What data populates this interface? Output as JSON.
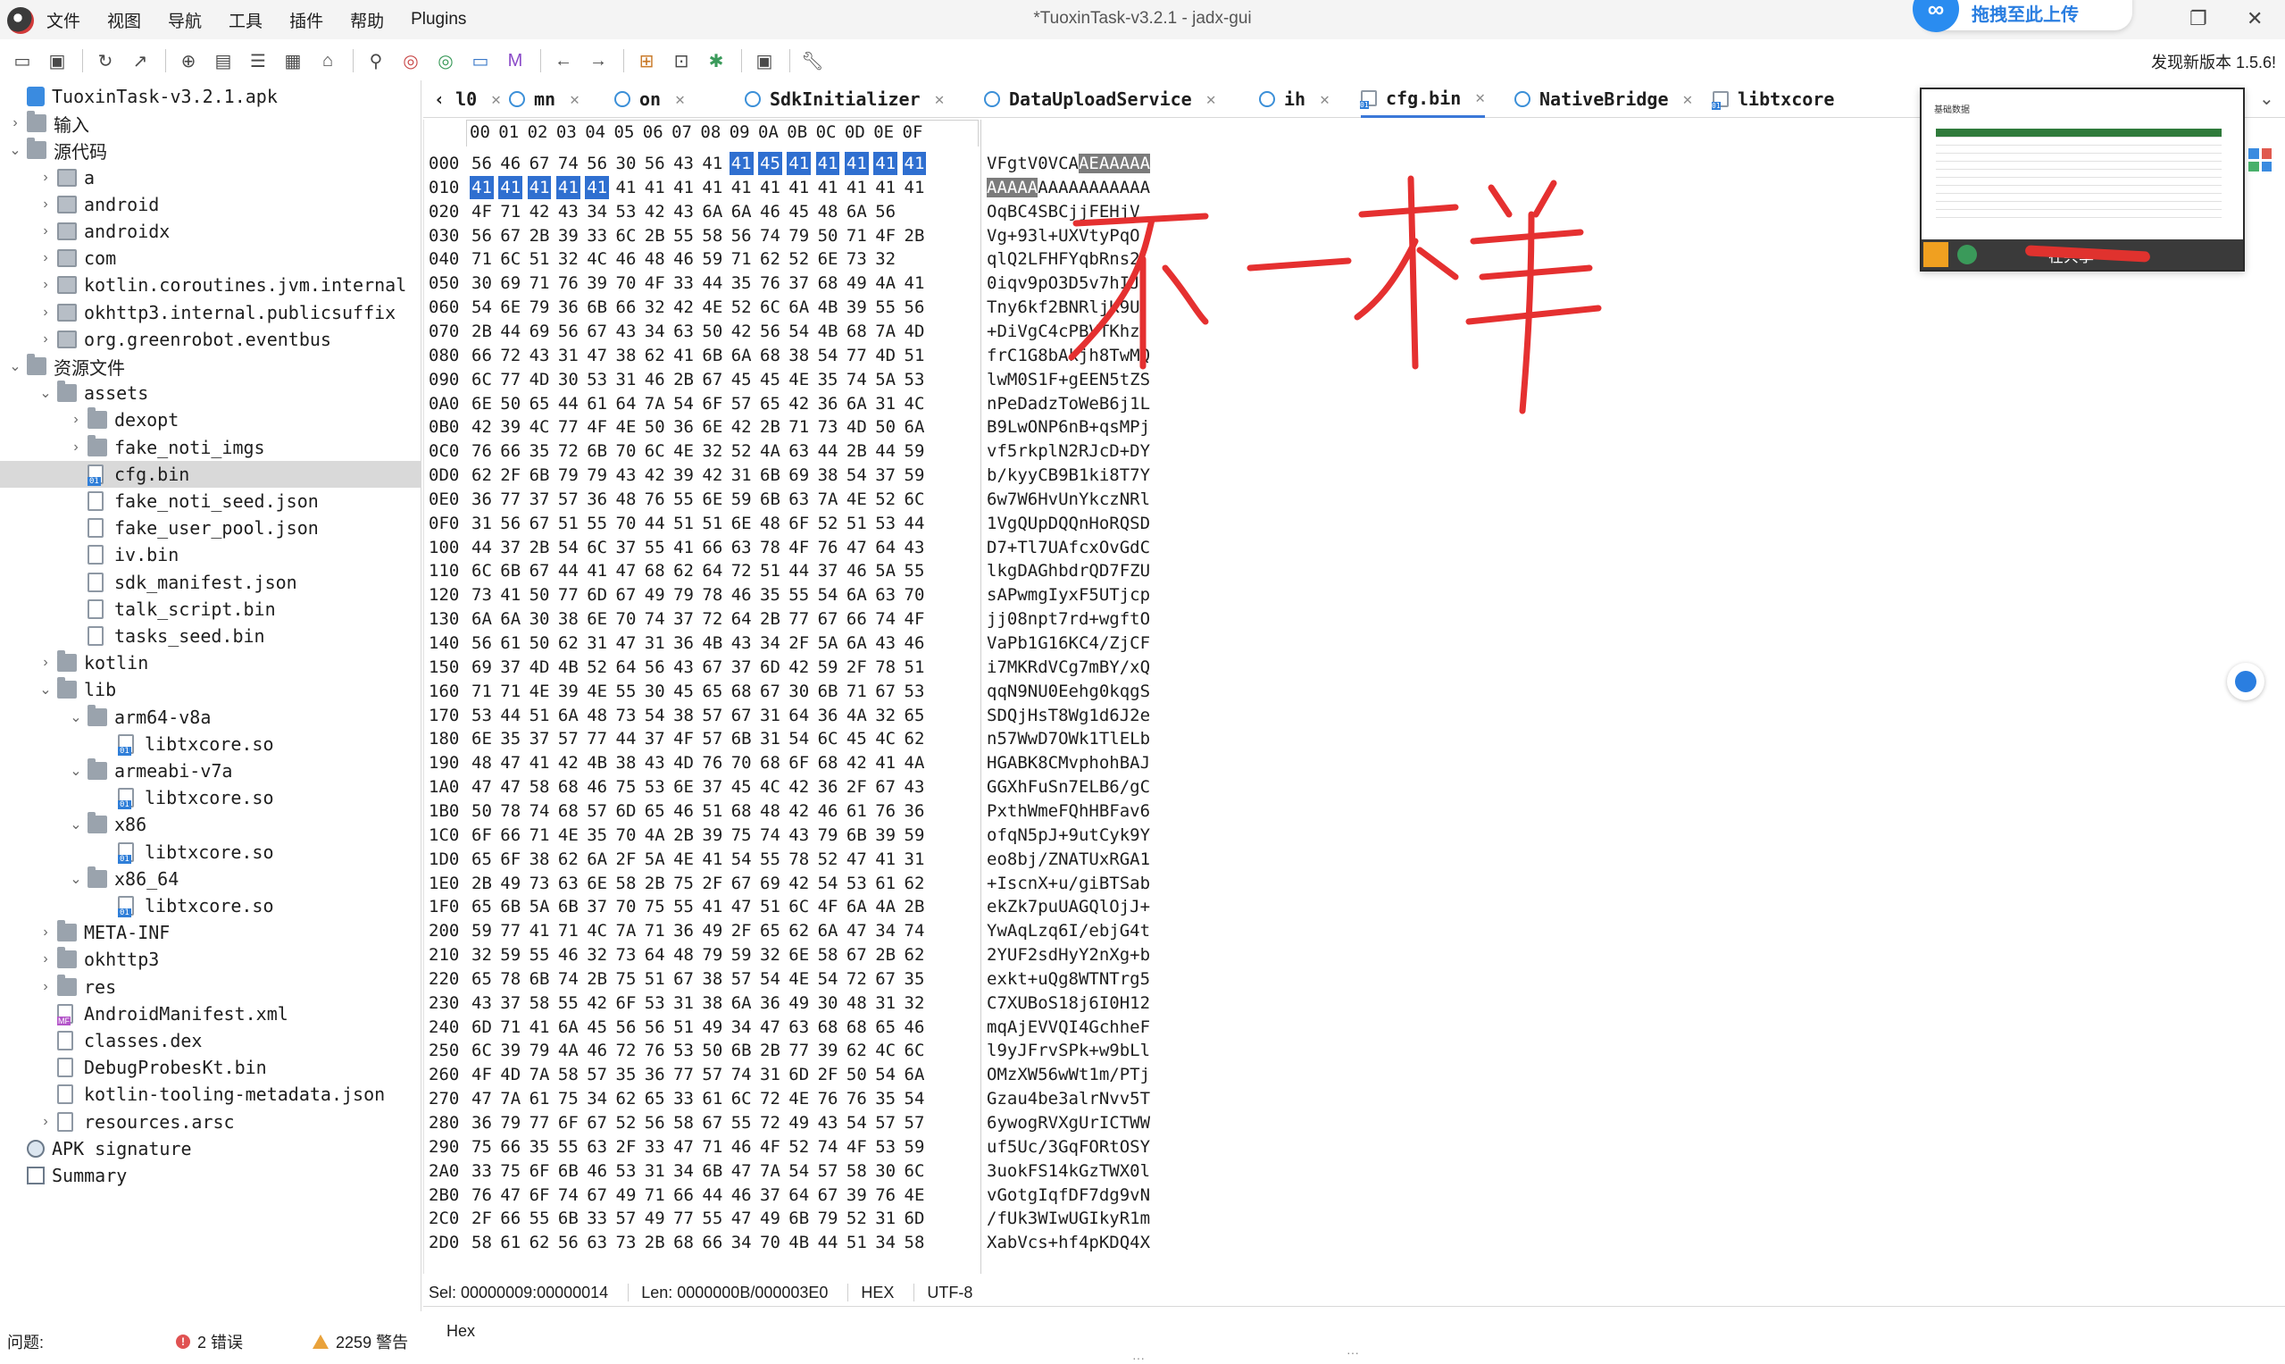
{
  "window": {
    "title": "*TuoxinTask-v3.2.1 - jadx-gui",
    "menus": [
      "文件",
      "视图",
      "导航",
      "工具",
      "插件",
      "帮助",
      "Plugins"
    ],
    "upload_banner": "拖拽至此上传",
    "update_notice": "发现新版本 1.5.6!"
  },
  "toolbar": {
    "icons": [
      "open-file-icon",
      "save-icon",
      "reload-icon",
      "export-icon",
      "sync-icon",
      "add-files-icon",
      "flatten-icon",
      "grid-icon",
      "home-icon",
      "search-icon",
      "find-class-icon",
      "find-usage-icon",
      "code-view-icon",
      "smali-icon",
      "back-icon",
      "forward-icon",
      "deobf-icon",
      "log-icon",
      "debug-icon",
      "quark-icon",
      "preferences-icon"
    ]
  },
  "tree": {
    "items": [
      {
        "label": "TuoxinTask-v3.2.1.apk",
        "icon": "apk-icon",
        "level": 0,
        "arrow": "",
        "mono": true
      },
      {
        "label": "输入",
        "icon": "folder-icon",
        "level": 0,
        "arrow": "›",
        "mono": false
      },
      {
        "label": "源代码",
        "icon": "folder-icon",
        "level": 0,
        "arrow": "⌄",
        "mono": false
      },
      {
        "label": "a",
        "icon": "package-icon",
        "level": 1,
        "arrow": "›",
        "mono": true
      },
      {
        "label": "android",
        "icon": "package-icon",
        "level": 1,
        "arrow": "›",
        "mono": true
      },
      {
        "label": "androidx",
        "icon": "package-icon",
        "level": 1,
        "arrow": "›",
        "mono": true
      },
      {
        "label": "com",
        "icon": "package-icon",
        "level": 1,
        "arrow": "›",
        "mono": true
      },
      {
        "label": "kotlin.coroutines.jvm.internal",
        "icon": "package-icon",
        "level": 1,
        "arrow": "›",
        "mono": true
      },
      {
        "label": "okhttp3.internal.publicsuffix",
        "icon": "package-icon",
        "level": 1,
        "arrow": "›",
        "mono": true
      },
      {
        "label": "org.greenrobot.eventbus",
        "icon": "package-icon",
        "level": 1,
        "arrow": "›",
        "mono": true
      },
      {
        "label": "资源文件",
        "icon": "folder-icon",
        "level": 0,
        "arrow": "⌄",
        "mono": false
      },
      {
        "label": "assets",
        "icon": "folder-icon",
        "level": 1,
        "arrow": "⌄",
        "mono": true
      },
      {
        "label": "dexopt",
        "icon": "folder-icon",
        "level": 2,
        "arrow": "›",
        "mono": true
      },
      {
        "label": "fake_noti_imgs",
        "icon": "folder-icon",
        "level": 2,
        "arrow": "›",
        "mono": true
      },
      {
        "label": "cfg.bin",
        "icon": "binary-file-icon",
        "level": 2,
        "arrow": "",
        "mono": true,
        "selected": true
      },
      {
        "label": "fake_noti_seed.json",
        "icon": "file-icon",
        "level": 2,
        "arrow": "",
        "mono": true
      },
      {
        "label": "fake_user_pool.json",
        "icon": "file-icon",
        "level": 2,
        "arrow": "",
        "mono": true
      },
      {
        "label": "iv.bin",
        "icon": "file-icon",
        "level": 2,
        "arrow": "",
        "mono": true
      },
      {
        "label": "sdk_manifest.json",
        "icon": "file-icon",
        "level": 2,
        "arrow": "",
        "mono": true
      },
      {
        "label": "talk_script.bin",
        "icon": "file-icon",
        "level": 2,
        "arrow": "",
        "mono": true
      },
      {
        "label": "tasks_seed.bin",
        "icon": "file-icon",
        "level": 2,
        "arrow": "",
        "mono": true
      },
      {
        "label": "kotlin",
        "icon": "folder-icon",
        "level": 1,
        "arrow": "›",
        "mono": true
      },
      {
        "label": "lib",
        "icon": "folder-icon",
        "level": 1,
        "arrow": "⌄",
        "mono": true
      },
      {
        "label": "arm64-v8a",
        "icon": "folder-icon",
        "level": 2,
        "arrow": "⌄",
        "mono": true
      },
      {
        "label": "libtxcore.so",
        "icon": "binary-file-icon",
        "level": 3,
        "arrow": "",
        "mono": true
      },
      {
        "label": "armeabi-v7a",
        "icon": "folder-icon",
        "level": 2,
        "arrow": "⌄",
        "mono": true
      },
      {
        "label": "libtxcore.so",
        "icon": "binary-file-icon",
        "level": 3,
        "arrow": "",
        "mono": true
      },
      {
        "label": "x86",
        "icon": "folder-icon",
        "level": 2,
        "arrow": "⌄",
        "mono": true
      },
      {
        "label": "libtxcore.so",
        "icon": "binary-file-icon",
        "level": 3,
        "arrow": "",
        "mono": true
      },
      {
        "label": "x86_64",
        "icon": "folder-icon",
        "level": 2,
        "arrow": "⌄",
        "mono": true
      },
      {
        "label": "libtxcore.so",
        "icon": "binary-file-icon",
        "level": 3,
        "arrow": "",
        "mono": true
      },
      {
        "label": "META-INF",
        "icon": "folder-icon",
        "level": 1,
        "arrow": "›",
        "mono": true
      },
      {
        "label": "okhttp3",
        "icon": "folder-icon",
        "level": 1,
        "arrow": "›",
        "mono": true
      },
      {
        "label": "res",
        "icon": "folder-icon",
        "level": 1,
        "arrow": "›",
        "mono": true
      },
      {
        "label": "AndroidManifest.xml",
        "icon": "manifest-icon",
        "level": 1,
        "arrow": "",
        "mono": true
      },
      {
        "label": "classes.dex",
        "icon": "file-icon",
        "level": 1,
        "arrow": "",
        "mono": true
      },
      {
        "label": "DebugProbesKt.bin",
        "icon": "file-icon",
        "level": 1,
        "arrow": "",
        "mono": true
      },
      {
        "label": "kotlin-tooling-metadata.json",
        "icon": "file-icon",
        "level": 1,
        "arrow": "",
        "mono": true
      },
      {
        "label": "resources.arsc",
        "icon": "file-icon",
        "level": 1,
        "arrow": "›",
        "mono": true
      },
      {
        "label": "APK signature",
        "icon": "certificate-icon",
        "level": 0,
        "arrow": "",
        "mono": true
      },
      {
        "label": "Summary",
        "icon": "summary-icon",
        "level": 0,
        "arrow": "",
        "mono": true
      }
    ]
  },
  "tabs": [
    {
      "label": "‹ l0",
      "icon": "",
      "active": false
    },
    {
      "label": "mn",
      "icon": "class-icon",
      "active": false
    },
    {
      "label": "on",
      "icon": "class-icon",
      "active": false
    },
    {
      "label": "SdkInitializer",
      "icon": "class-icon",
      "active": false
    },
    {
      "label": "DataUploadService",
      "icon": "class-icon",
      "active": false
    },
    {
      "label": "ih",
      "icon": "class-icon",
      "active": false
    },
    {
      "label": "cfg.bin",
      "icon": "binary-file-icon",
      "active": true
    },
    {
      "label": "NativeBridge",
      "icon": "class-icon",
      "active": false
    },
    {
      "label": "libtxcore",
      "icon": "binary-file-icon",
      "active": false
    }
  ],
  "hex": {
    "header": [
      "00",
      "01",
      "02",
      "03",
      "04",
      "05",
      "06",
      "07",
      "08",
      "09",
      "0A",
      "0B",
      "0C",
      "0D",
      "0E",
      "0F"
    ],
    "selection": {
      "start": 9,
      "end": 20,
      "ascii_start": 9,
      "ascii_end": 20
    },
    "rows": [
      {
        "off": "000",
        "bytes": "56 46 67 74 56 30 56 43 41 41 45 41 41 41 41 41",
        "ascii": "VFgtV0VCAAEAAAAA"
      },
      {
        "off": "010",
        "bytes": "41 41 41 41 41 41 41 41 41 41 41 41 41 41 41 41",
        "ascii": "AAAAAAAAAAAAAAAA"
      },
      {
        "off": "020",
        "bytes": "4F 71 42 43 34 53 42 43 6A 6A 46 45 48 6A 56",
        "ascii": "OqBC4SBCjjFEHjV"
      },
      {
        "off": "030",
        "bytes": "56 67 2B 39 33 6C 2B 55 58 56 74 79 50 71 4F 2B",
        "ascii": "Vg+93l+UXVtyPqO"
      },
      {
        "off": "040",
        "bytes": "71 6C 51 32 4C 46 48 46 59 71 62 52 6E 73 32",
        "ascii": "qlQ2LFHFYqbRns2"
      },
      {
        "off": "050",
        "bytes": "30 69 71 76 39 70 4F 33 44 35 76 37 68 49 4A 41",
        "ascii": "0iqv9pO3D5v7hIJ"
      },
      {
        "off": "060",
        "bytes": "54 6E 79 36 6B 66 32 42 4E 52 6C 6A 4B 39 55 56",
        "ascii": "Tny6kf2BNRljK9U"
      },
      {
        "off": "070",
        "bytes": "2B 44 69 56 67 43 34 63 50 42 56 54 4B 68 7A 4D",
        "ascii": "+DiVgC4cPBVTKhz"
      },
      {
        "off": "080",
        "bytes": "66 72 43 31 47 38 62 41 6B 6A 68 38 54 77 4D 51",
        "ascii": "frC1G8bAkjh8TwMQ"
      },
      {
        "off": "090",
        "bytes": "6C 77 4D 30 53 31 46 2B 67 45 45 4E 35 74 5A 53",
        "ascii": "lwM0S1F+gEEN5tZS"
      },
      {
        "off": "0A0",
        "bytes": "6E 50 65 44 61 64 7A 54 6F 57 65 42 36 6A 31 4C",
        "ascii": "nPeDadzToWeB6j1L"
      },
      {
        "off": "0B0",
        "bytes": "42 39 4C 77 4F 4E 50 36 6E 42 2B 71 73 4D 50 6A",
        "ascii": "B9LwONP6nB+qsMPj"
      },
      {
        "off": "0C0",
        "bytes": "76 66 35 72 6B 70 6C 4E 32 52 4A 63 44 2B 44 59",
        "ascii": "vf5rkplN2RJcD+DY"
      },
      {
        "off": "0D0",
        "bytes": "62 2F 6B 79 79 43 42 39 42 31 6B 69 38 54 37 59",
        "ascii": "b/kyyCB9B1ki8T7Y"
      },
      {
        "off": "0E0",
        "bytes": "36 77 37 57 36 48 76 55 6E 59 6B 63 7A 4E 52 6C",
        "ascii": "6w7W6HvUnYkczNRl"
      },
      {
        "off": "0F0",
        "bytes": "31 56 67 51 55 70 44 51 51 6E 48 6F 52 51 53 44",
        "ascii": "1VgQUpDQQnHoRQSD"
      },
      {
        "off": "100",
        "bytes": "44 37 2B 54 6C 37 55 41 66 63 78 4F 76 47 64 43",
        "ascii": "D7+Tl7UAfcxOvGdC"
      },
      {
        "off": "110",
        "bytes": "6C 6B 67 44 41 47 68 62 64 72 51 44 37 46 5A 55",
        "ascii": "lkgDAGhbdrQD7FZU"
      },
      {
        "off": "120",
        "bytes": "73 41 50 77 6D 67 49 79 78 46 35 55 54 6A 63 70",
        "ascii": "sAPwmgIyxF5UTjcp"
      },
      {
        "off": "130",
        "bytes": "6A 6A 30 38 6E 70 74 37 72 64 2B 77 67 66 74 4F",
        "ascii": "jj08npt7rd+wgftO"
      },
      {
        "off": "140",
        "bytes": "56 61 50 62 31 47 31 36 4B 43 34 2F 5A 6A 43 46",
        "ascii": "VaPb1G16KC4/ZjCF"
      },
      {
        "off": "150",
        "bytes": "69 37 4D 4B 52 64 56 43 67 37 6D 42 59 2F 78 51",
        "ascii": "i7MKRdVCg7mBY/xQ"
      },
      {
        "off": "160",
        "bytes": "71 71 4E 39 4E 55 30 45 65 68 67 30 6B 71 67 53",
        "ascii": "qqN9NU0Eehg0kqgS"
      },
      {
        "off": "170",
        "bytes": "53 44 51 6A 48 73 54 38 57 67 31 64 36 4A 32 65",
        "ascii": "SDQjHsT8Wg1d6J2e"
      },
      {
        "off": "180",
        "bytes": "6E 35 37 57 77 44 37 4F 57 6B 31 54 6C 45 4C 62",
        "ascii": "n57WwD7OWk1TlELb"
      },
      {
        "off": "190",
        "bytes": "48 47 41 42 4B 38 43 4D 76 70 68 6F 68 42 41 4A",
        "ascii": "HGABK8CMvphohBAJ"
      },
      {
        "off": "1A0",
        "bytes": "47 47 58 68 46 75 53 6E 37 45 4C 42 36 2F 67 43",
        "ascii": "GGXhFuSn7ELB6/gC"
      },
      {
        "off": "1B0",
        "bytes": "50 78 74 68 57 6D 65 46 51 68 48 42 46 61 76 36",
        "ascii": "PxthWmeFQhHBFav6"
      },
      {
        "off": "1C0",
        "bytes": "6F 66 71 4E 35 70 4A 2B 39 75 74 43 79 6B 39 59",
        "ascii": "ofqN5pJ+9utCyk9Y"
      },
      {
        "off": "1D0",
        "bytes": "65 6F 38 62 6A 2F 5A 4E 41 54 55 78 52 47 41 31",
        "ascii": "eo8bj/ZNATUxRGA1"
      },
      {
        "off": "1E0",
        "bytes": "2B 49 73 63 6E 58 2B 75 2F 67 69 42 54 53 61 62",
        "ascii": "+IscnX+u/giBTSab"
      },
      {
        "off": "1F0",
        "bytes": "65 6B 5A 6B 37 70 75 55 41 47 51 6C 4F 6A 4A 2B",
        "ascii": "ekZk7puUAGQlOjJ+"
      },
      {
        "off": "200",
        "bytes": "59 77 41 71 4C 7A 71 36 49 2F 65 62 6A 47 34 74",
        "ascii": "YwAqLzq6I/ebjG4t"
      },
      {
        "off": "210",
        "bytes": "32 59 55 46 32 73 64 48 79 59 32 6E 58 67 2B 62",
        "ascii": "2YUF2sdHyY2nXg+b"
      },
      {
        "off": "220",
        "bytes": "65 78 6B 74 2B 75 51 67 38 57 54 4E 54 72 67 35",
        "ascii": "exkt+uQg8WTNTrg5"
      },
      {
        "off": "230",
        "bytes": "43 37 58 55 42 6F 53 31 38 6A 36 49 30 48 31 32",
        "ascii": "C7XUBoS18j6I0H12"
      },
      {
        "off": "240",
        "bytes": "6D 71 41 6A 45 56 56 51 49 34 47 63 68 68 65 46",
        "ascii": "mqAjEVVQI4GchheF"
      },
      {
        "off": "250",
        "bytes": "6C 39 79 4A 46 72 76 53 50 6B 2B 77 39 62 4C 6C",
        "ascii": "l9yJFrvSPk+w9bLl"
      },
      {
        "off": "260",
        "bytes": "4F 4D 7A 58 57 35 36 77 57 74 31 6D 2F 50 54 6A",
        "ascii": "OMzXW56wWt1m/PTj"
      },
      {
        "off": "270",
        "bytes": "47 7A 61 75 34 62 65 33 61 6C 72 4E 76 76 35 54",
        "ascii": "Gzau4be3alrNvv5T"
      },
      {
        "off": "280",
        "bytes": "36 79 77 6F 67 52 56 58 67 55 72 49 43 54 57 57",
        "ascii": "6ywogRVXgUrICTWW"
      },
      {
        "off": "290",
        "bytes": "75 66 35 55 63 2F 33 47 71 46 4F 52 74 4F 53 59",
        "ascii": "uf5Uc/3GqFORtOSY"
      },
      {
        "off": "2A0",
        "bytes": "33 75 6F 6B 46 53 31 34 6B 47 7A 54 57 58 30 6C",
        "ascii": "3uokFS14kGzTWX0l"
      },
      {
        "off": "2B0",
        "bytes": "76 47 6F 74 67 49 71 66 44 46 37 64 67 39 76 4E",
        "ascii": "vGotgIqfDF7dg9vN"
      },
      {
        "off": "2C0",
        "bytes": "2F 66 55 6B 33 57 49 77 55 47 49 6B 79 52 31 6D",
        "ascii": "/fUk3WIwUGIkyR1m"
      },
      {
        "off": "2D0",
        "bytes": "58 61 62 56 63 73 2B 68 66 34 70 4B 44 51 34 58",
        "ascii": "XabVcs+hf4pKDQ4X"
      }
    ]
  },
  "hex_status": {
    "selection": "Sel: 00000009:00000014",
    "length": "Len: 0000000B/000003E0",
    "mode": "HEX",
    "encoding": "UTF-8",
    "view_tab": "Hex"
  },
  "problems": {
    "label": "问题:",
    "errors": "2 错误",
    "warnings": "2259 警告"
  },
  "annotation": {
    "text": "不一样",
    "color": "#e53030"
  },
  "share_overlay": {
    "title": "基础数据",
    "status": "在共享"
  }
}
